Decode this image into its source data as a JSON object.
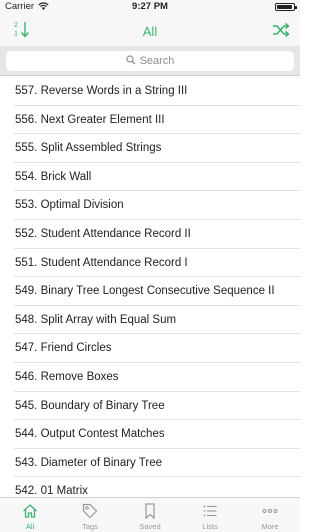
{
  "status_bar": {
    "carrier": "Carrier",
    "time": "9:27 PM",
    "battery_level": 0.95
  },
  "nav": {
    "title": "All",
    "sort_label_top": "2",
    "sort_label_bottom": "1"
  },
  "search": {
    "placeholder": "Search"
  },
  "problems": [
    "557. Reverse Words in a String III",
    "556. Next Greater Element III",
    "555. Split Assembled Strings",
    "554. Brick Wall",
    "553. Optimal Division",
    "552. Student Attendance Record II",
    "551. Student Attendance Record I",
    "549. Binary Tree Longest Consecutive Sequence II",
    "548. Split Array with Equal Sum",
    "547. Friend Circles",
    "546. Remove Boxes",
    "545. Boundary of Binary Tree",
    "544. Output Contest Matches",
    "543. Diameter of Binary Tree",
    "542. 01 Matrix"
  ],
  "tabs": [
    {
      "label": "All",
      "icon": "home-icon",
      "active": true
    },
    {
      "label": "Tags",
      "icon": "tag-icon",
      "active": false
    },
    {
      "label": "Saved",
      "icon": "bookmark-icon",
      "active": false
    },
    {
      "label": "Lists",
      "icon": "list-icon",
      "active": false
    },
    {
      "label": "More",
      "icon": "more-icon",
      "active": false
    }
  ],
  "colors": {
    "accent": "#3cb371",
    "inactive": "#999999"
  }
}
